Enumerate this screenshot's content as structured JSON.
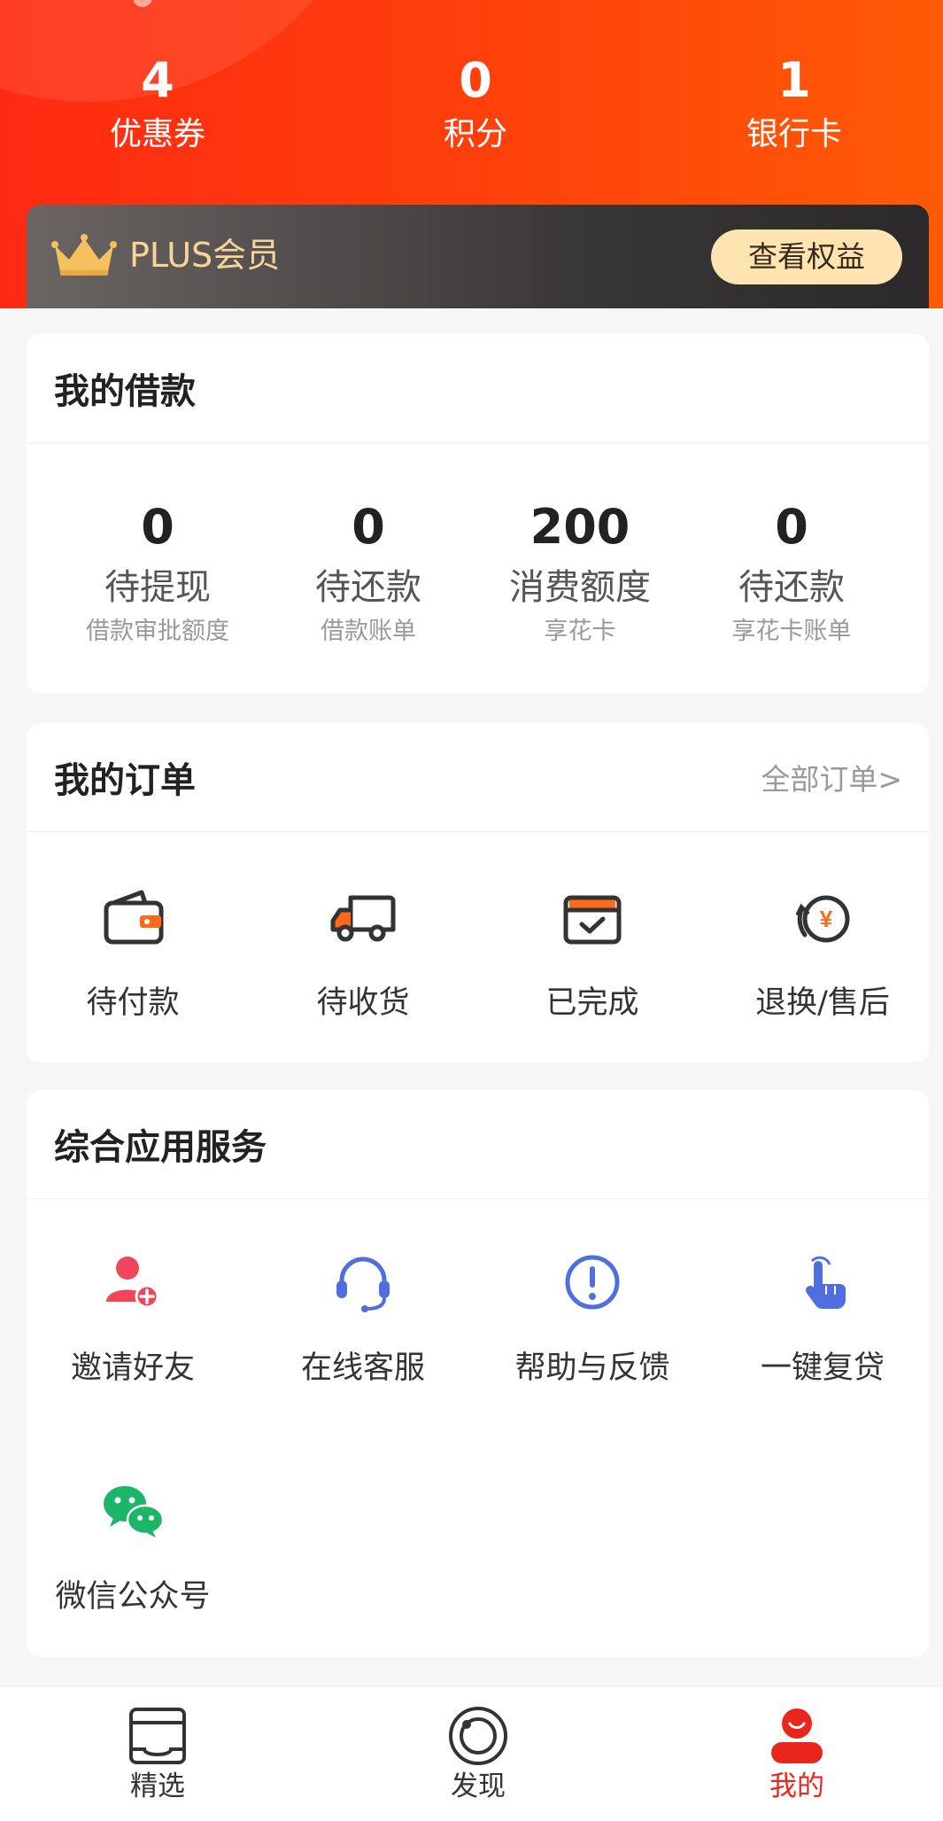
{
  "header": {
    "stats": [
      {
        "value": "4",
        "label": "优惠券"
      },
      {
        "value": "0",
        "label": "积分"
      },
      {
        "value": "1",
        "label": "银行卡"
      }
    ],
    "plus": {
      "label": "PLUS会员",
      "button": "查看权益"
    }
  },
  "loans": {
    "title": "我的借款",
    "items": [
      {
        "value": "0",
        "title": "待提现",
        "sub": "借款审批额度"
      },
      {
        "value": "0",
        "title": "待还款",
        "sub": "借款账单"
      },
      {
        "value": "200",
        "title": "消费额度",
        "sub": "享花卡"
      },
      {
        "value": "0",
        "title": "待还款",
        "sub": "享花卡账单"
      }
    ]
  },
  "orders": {
    "title": "我的订单",
    "more": "全部订单>",
    "items": [
      {
        "label": "待付款",
        "icon": "wallet-icon"
      },
      {
        "label": "待收货",
        "icon": "truck-icon"
      },
      {
        "label": "已完成",
        "icon": "box-check-icon"
      },
      {
        "label": "退换/售后",
        "icon": "refund-icon"
      }
    ]
  },
  "services": {
    "title": "综合应用服务",
    "items": [
      {
        "label": "邀请好友",
        "icon": "invite-user-icon"
      },
      {
        "label": "在线客服",
        "icon": "headset-icon"
      },
      {
        "label": "帮助与反馈",
        "icon": "help-icon"
      },
      {
        "label": "一键复贷",
        "icon": "tap-hand-icon"
      },
      {
        "label": "微信公众号",
        "icon": "wechat-icon"
      }
    ]
  },
  "tabbar": {
    "tabs": [
      {
        "label": "精选",
        "icon": "featured-icon"
      },
      {
        "label": "发现",
        "icon": "discover-icon"
      },
      {
        "label": "我的",
        "icon": "profile-icon",
        "active": true
      }
    ]
  },
  "colors": {
    "brand_red": "#e8261c",
    "header_orange": "#ff5a06",
    "gold": "#f6d59b",
    "blue_icon": "#4f6fe0",
    "green_icon": "#1db567"
  }
}
